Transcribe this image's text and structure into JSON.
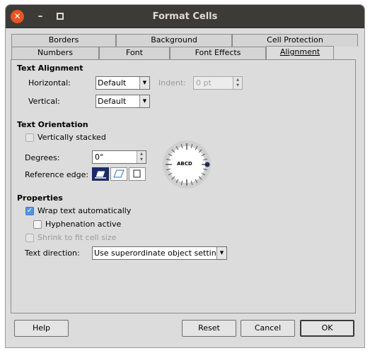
{
  "window": {
    "title": "Format Cells"
  },
  "titlebar": {
    "close_glyph": "✕",
    "min_glyph": "–"
  },
  "tabs_row1": [
    "Borders",
    "Background",
    "Cell Protection"
  ],
  "tabs_row2": [
    "Numbers",
    "Font",
    "Font Effects",
    "Alignment"
  ],
  "active_tab": "Alignment",
  "text_alignment": {
    "heading": "Text Alignment",
    "horizontal_label": "Horizontal:",
    "horizontal_value": "Default",
    "indent_label": "Indent:",
    "indent_value": "0 pt",
    "vertical_label": "Vertical:",
    "vertical_value": "Default"
  },
  "text_orientation": {
    "heading": "Text Orientation",
    "vertically_stacked_label": "Vertically stacked",
    "degrees_label": "Degrees:",
    "degrees_value": "0°",
    "reference_edge_label": "Reference edge:",
    "dial_text": "ABCD"
  },
  "properties": {
    "heading": "Properties",
    "wrap_text_label": "Wrap text automatically",
    "wrap_text_checked": true,
    "hyphenation_label": "Hyphenation active",
    "shrink_label": "Shrink to fit cell size",
    "text_direction_label": "Text direction:",
    "text_direction_value": "Use superordinate object settings"
  },
  "buttons": {
    "help": "Help",
    "reset": "Reset",
    "cancel": "Cancel",
    "ok": "OK"
  },
  "colors": {
    "titlebar": "#3c3b37",
    "close": "#e95420",
    "check_accent": "#5294e2",
    "selected_ref": "#1c2a66"
  }
}
